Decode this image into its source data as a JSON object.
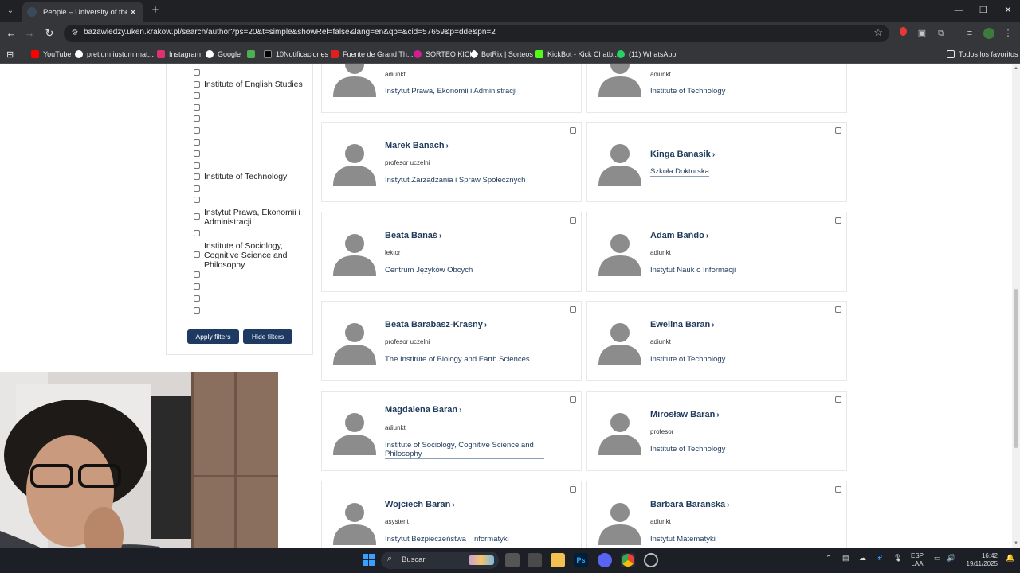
{
  "browser": {
    "tab_title": "People – University of the Natio",
    "url": "bazawiedzy.uken.krakow.pl/search/author?ps=20&t=simple&showRel=false&lang=en&qp=&cid=57659&p=dde&pn=2",
    "bookmarks": [
      {
        "label": "YouTube",
        "icon": "youtube-icon",
        "color": "#ff0000"
      },
      {
        "label": "pretium iustum mat...",
        "icon": "google-icon",
        "color": "#ffffff"
      },
      {
        "label": "Instagram",
        "icon": "instagram-icon",
        "color": "#e1306c"
      },
      {
        "label": "Google",
        "icon": "google-icon",
        "color": "#ffffff"
      },
      {
        "label": "",
        "icon": "pinwheel-icon",
        "color": "#4caf50"
      },
      {
        "label": "10Notificaciones",
        "icon": "x-icon",
        "color": "#000000"
      },
      {
        "label": "Fuente de Grand Th...",
        "icon": "fandom-icon",
        "color": "#e02020"
      },
      {
        "label": "SORTEO KICK",
        "icon": "star-icon",
        "color": "#d02090"
      },
      {
        "label": "BotRix | Sorteos",
        "icon": "botrix-icon",
        "color": "#ffffff"
      },
      {
        "label": "KickBot - Kick Chatb...",
        "icon": "kickbot-icon",
        "color": "#53fc18"
      },
      {
        "label": "(11) WhatsApp",
        "icon": "whatsapp-icon",
        "color": "#25d366"
      }
    ],
    "all_bookmarks_label": "Todos los favoritos"
  },
  "filters": {
    "labels": {
      "english": "Institute of English Studies",
      "technology": "Institute of Technology",
      "prawa": "Instytut Prawa, Ekonomii i Administracji",
      "sociology": "Institute of Sociology, Cognitive Science and Philosophy"
    },
    "apply_label": "Apply filters",
    "hide_label": "Hide filters"
  },
  "people": [
    {
      "name": "",
      "role": "adiunkt",
      "unit": "Instytut Prawa, Ekonomii i Administracji"
    },
    {
      "name": "",
      "role": "adiunkt",
      "unit": "Institute of Technology"
    },
    {
      "name": "Marek Banach",
      "role": "profesor uczelni",
      "unit": "Instytut Zarządzania i Spraw Społecznych"
    },
    {
      "name": "Kinga Banasik",
      "role": "",
      "unit": "Szkoła Doktorska"
    },
    {
      "name": "Beata Banaś",
      "role": "lektor",
      "unit": "Centrum Języków Obcych"
    },
    {
      "name": "Adam Bańdo",
      "role": "adiunkt",
      "unit": "Instytut Nauk o Informacji"
    },
    {
      "name": "Beata Barabasz-Krasny",
      "role": "profesor uczelni",
      "unit": "The Institute of Biology and Earth Sciences"
    },
    {
      "name": "Ewelina Baran",
      "role": "adiunkt",
      "unit": "Institute of Technology"
    },
    {
      "name": "Magdalena Baran",
      "role": "adiunkt",
      "unit": "Institute of Sociology, Cognitive Science and Philosophy"
    },
    {
      "name": "Mirosław Baran",
      "role": "profesor",
      "unit": "Institute of Technology"
    },
    {
      "name": "Wojciech Baran",
      "role": "asystent",
      "unit": "Instytut Bezpieczeństwa i Informatyki"
    },
    {
      "name": "Barbara Barańska",
      "role": "adiunkt",
      "unit": "Instytut Matematyki"
    }
  ],
  "taskbar": {
    "search_placeholder": "Buscar",
    "lang_top": "ESP",
    "lang_bottom": "LAA",
    "time": "16:42",
    "date": "19/11/2025"
  }
}
